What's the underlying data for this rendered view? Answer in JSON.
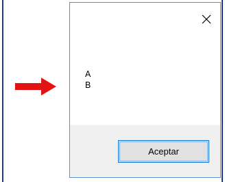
{
  "dialog": {
    "message_lines": [
      "A",
      "B"
    ],
    "ok_label": "Aceptar",
    "close_icon": "close-icon"
  },
  "arrow": {
    "icon": "arrow-right-icon",
    "color": "#e41313"
  },
  "colors": {
    "dialog_border": "#5b8fd6",
    "footer_bg": "#f0f0f0",
    "button_border": "#1e74d4",
    "frame_lines": "#1f3b8a"
  }
}
